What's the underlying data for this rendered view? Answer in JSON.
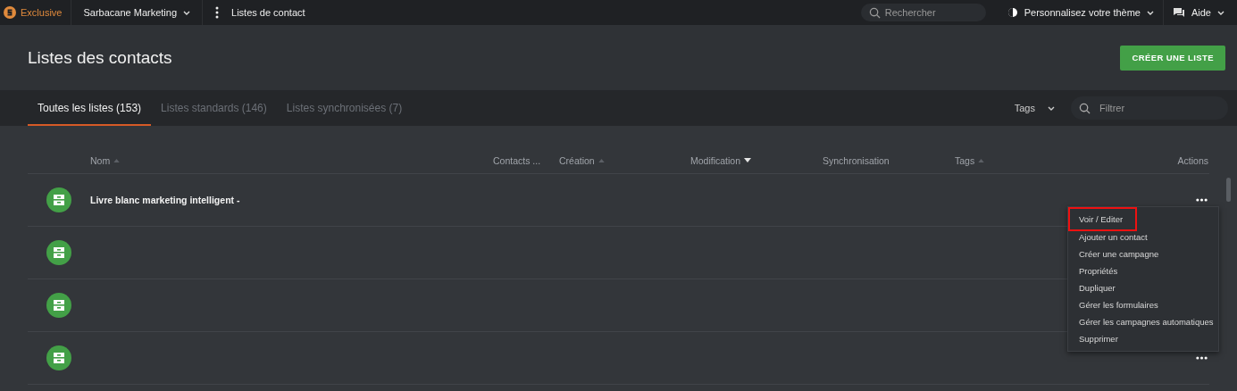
{
  "topbar": {
    "plan": "Exclusive",
    "account": "Sarbacane Marketing",
    "section": "Listes de contact",
    "search": {
      "placeholder": "Rechercher"
    },
    "theme": "Personnalisez votre thème",
    "help": "Aide"
  },
  "page": {
    "title": "Listes des contacts",
    "create_button": "CRÉER UNE LISTE"
  },
  "tabs": [
    {
      "label": "Toutes les listes (153)",
      "selected": true
    },
    {
      "label": "Listes standards (146)",
      "selected": false
    },
    {
      "label": "Listes synchronisées (7)",
      "selected": false
    }
  ],
  "filters": {
    "tags": "Tags",
    "search": {
      "placeholder": "Filtrer"
    }
  },
  "table": {
    "columns": [
      {
        "label": "Nom",
        "sortable": true,
        "sorted": false
      },
      {
        "label": "Contacts ...",
        "sortable": false
      },
      {
        "label": "Création",
        "sortable": true,
        "sorted": false
      },
      {
        "label": "Modification",
        "sortable": true,
        "sorted": true
      },
      {
        "label": "Synchronisation",
        "sortable": false
      },
      {
        "label": "Tags",
        "sortable": true,
        "sorted": false
      },
      {
        "label": "Actions",
        "sortable": false
      }
    ],
    "rows": [
      {
        "name": "Livre blanc marketing intelligent -",
        "actions_button": true
      },
      {
        "actions_button": false
      },
      {
        "actions_button": false
      },
      {
        "actions_button": true
      }
    ]
  },
  "menu": {
    "items": [
      {
        "label": "Voir / Editer",
        "highlighted": true
      },
      {
        "label": "Ajouter un contact",
        "highlighted": false
      },
      {
        "label": "Créer une campagne",
        "highlighted": false
      },
      {
        "label": "Propriétés",
        "highlighted": false
      },
      {
        "label": "Dupliquer",
        "highlighted": false
      },
      {
        "label": "Gérer les formulaires",
        "highlighted": false
      },
      {
        "label": "Gérer les campagnes automatiques",
        "highlighted": false
      },
      {
        "label": "Supprimer",
        "highlighted": false
      }
    ]
  }
}
